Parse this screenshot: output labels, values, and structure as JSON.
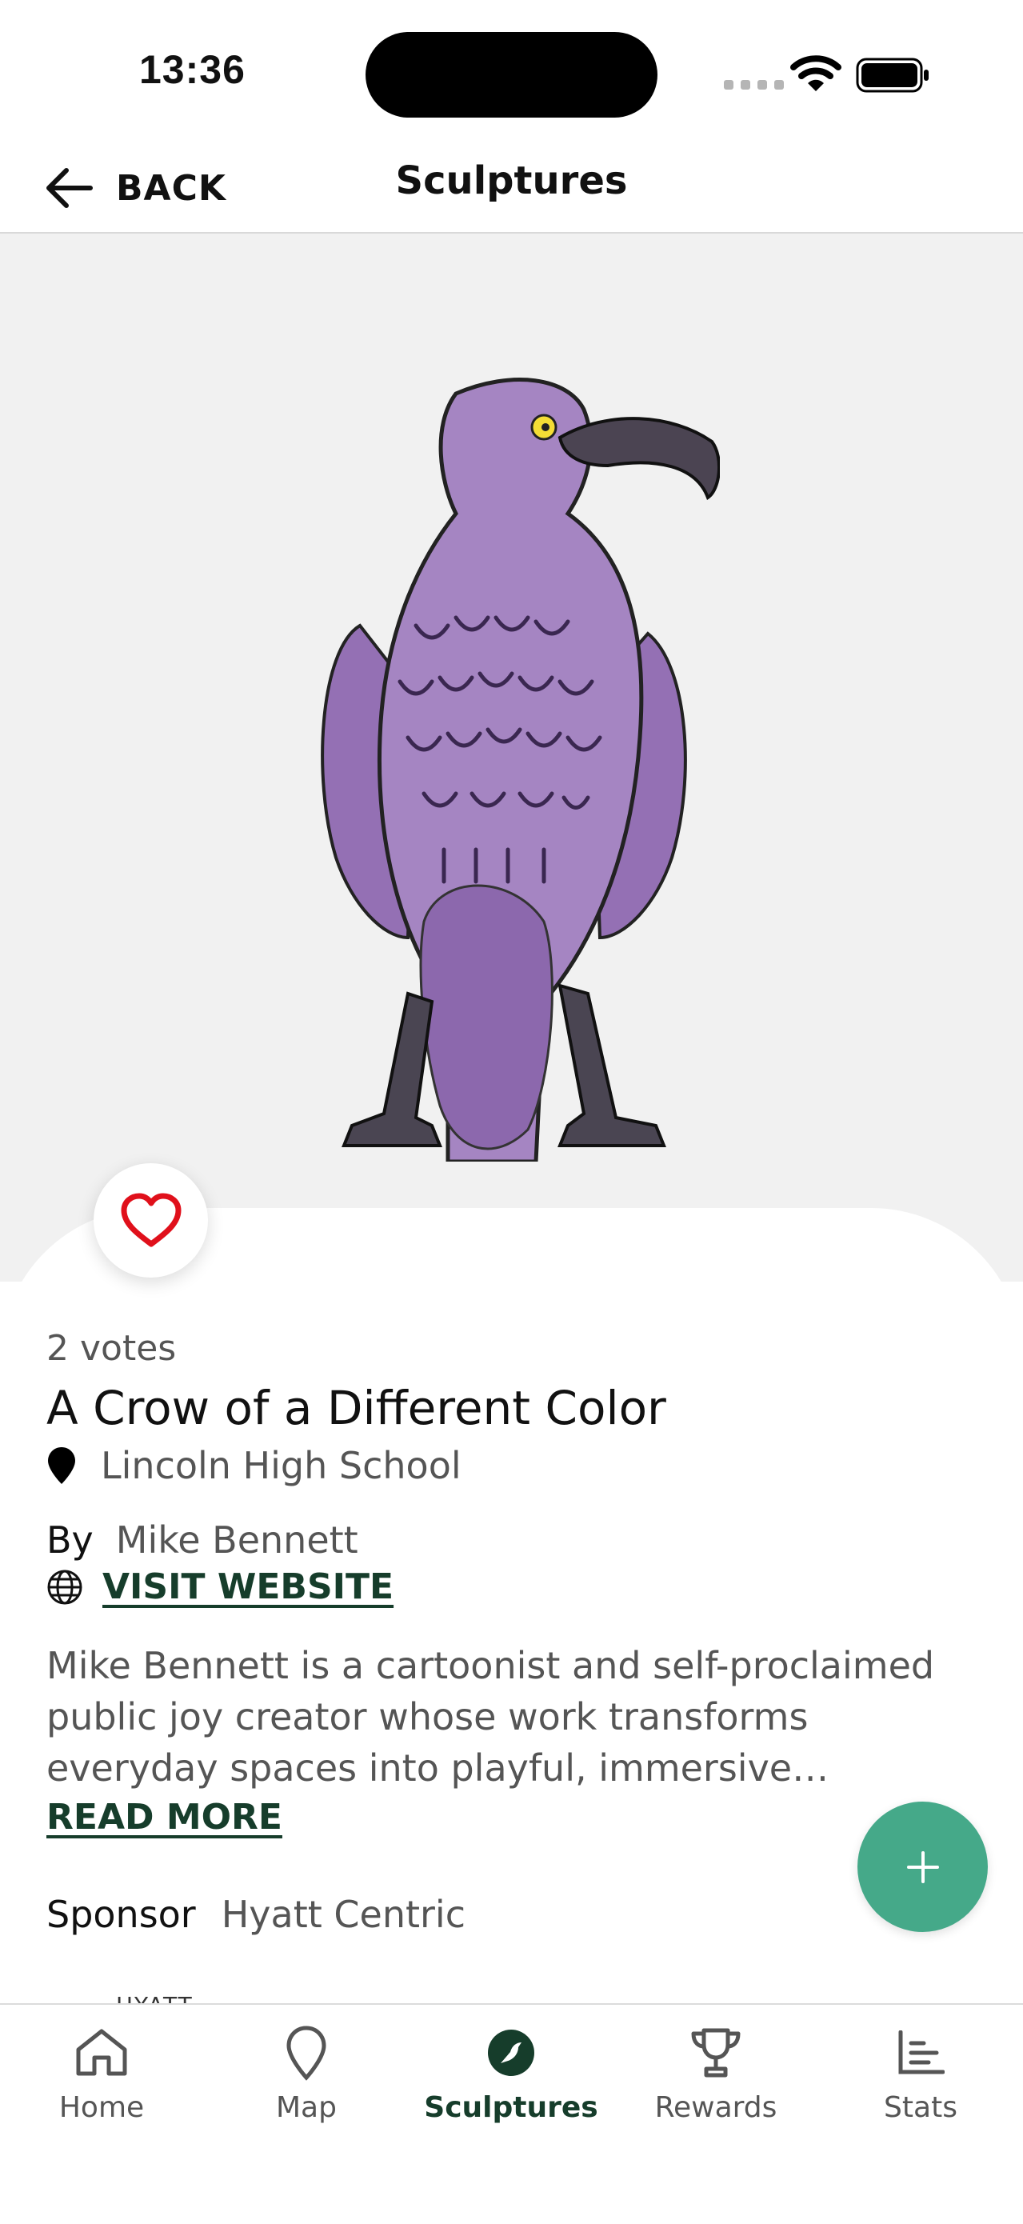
{
  "status_bar": {
    "time": "13:36"
  },
  "nav": {
    "back_label": "BACK",
    "title": "Sculptures"
  },
  "sculpture": {
    "votes": "2 votes",
    "title": "A Crow of a Different Color",
    "location": "Lincoln High School",
    "by_label": "By",
    "artist": "Mike Bennett",
    "website_label": "VISIT WEBSITE",
    "bio": "Mike Bennett is a cartoonist and self-proclaimed public joy creator whose work transforms everyday spaces into playful, immersive experiences. Known f...",
    "read_more_label": "READ MORE",
    "sponsor_label": "Sponsor",
    "sponsor_name": "Hyatt Centric",
    "sponsor_logo_text": "HYATT"
  },
  "tabs": [
    {
      "label": "Home",
      "icon": "home-icon"
    },
    {
      "label": "Map",
      "icon": "map-pin-icon"
    },
    {
      "label": "Sculptures",
      "icon": "sculptures-bird-icon",
      "active": true
    },
    {
      "label": "Rewards",
      "icon": "trophy-icon"
    },
    {
      "label": "Stats",
      "icon": "chart-icon"
    }
  ],
  "colors": {
    "accent": "#45a989",
    "link": "#163d2b",
    "heart": "#e0101b",
    "sculpture_purple": "#a585c2",
    "hero_bg": "#f1f1f1"
  }
}
